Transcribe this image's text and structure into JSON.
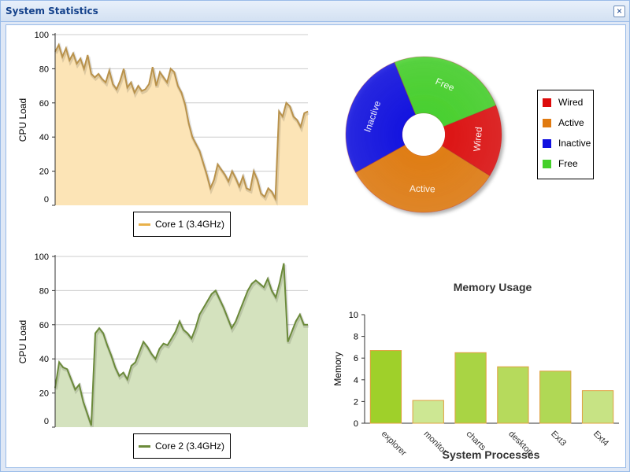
{
  "window": {
    "title": "System Statistics"
  },
  "colors": {
    "core1_line": "#b9924b",
    "core1_fill": "#fce4b6",
    "core1_legend": "#e8b14a",
    "core2_line": "#6b8a3a",
    "core2_fill": "#d4e2be",
    "core2_legend": "#6b8a3a",
    "grid": "#cccccc"
  },
  "cpu1": {
    "ylabel": "CPU Load",
    "legend_label": "Core 1 (3.4GHz)",
    "ticks": [
      "0",
      "20",
      "40",
      "60",
      "80",
      "100"
    ]
  },
  "cpu2": {
    "ylabel": "CPU Load",
    "legend_label": "Core 2 (3.4GHz)",
    "ticks": [
      "0",
      "20",
      "40",
      "60",
      "80",
      "100"
    ]
  },
  "pie": {
    "legend": [
      {
        "label": "Wired",
        "color": "#dd0b0b"
      },
      {
        "label": "Active",
        "color": "#e07a10"
      },
      {
        "label": "Inactive",
        "color": "#1010e0"
      },
      {
        "label": "Free",
        "color": "#44d02a"
      }
    ]
  },
  "bar": {
    "title": "Memory Usage",
    "xlabel": "System Processes",
    "ylabel": "Memory",
    "ticks": [
      "0",
      "2",
      "4",
      "6",
      "8",
      "10"
    ]
  },
  "chart_data": [
    {
      "type": "area",
      "ylabel": "CPU Load",
      "ylim": [
        0,
        100
      ],
      "grid": true,
      "legend": "bottom",
      "series": [
        {
          "name": "Core 1 (3.4GHz)",
          "values": [
            90,
            94,
            87,
            92,
            85,
            89,
            83,
            86,
            80,
            88,
            77,
            75,
            77,
            74,
            72,
            79,
            71,
            68,
            73,
            80,
            69,
            72,
            66,
            70,
            67,
            68,
            71,
            81,
            70,
            78,
            75,
            72,
            80,
            78,
            70,
            66,
            59,
            48,
            40,
            36,
            32,
            25,
            18,
            10,
            15,
            24,
            21,
            18,
            14,
            20,
            16,
            11,
            17,
            10,
            9,
            20,
            15,
            7,
            5,
            10,
            8,
            4,
            55,
            52,
            60,
            58,
            52,
            50,
            46,
            54,
            55
          ]
        }
      ]
    },
    {
      "type": "pie",
      "slices": [
        {
          "label": "Wired",
          "value": 15
        },
        {
          "label": "Active",
          "value": 33
        },
        {
          "label": "Inactive",
          "value": 27
        },
        {
          "label": "Free",
          "value": 25
        }
      ],
      "legend": "right"
    },
    {
      "type": "area",
      "ylabel": "CPU Load",
      "ylim": [
        0,
        100
      ],
      "grid": true,
      "legend": "bottom",
      "series": [
        {
          "name": "Core 2 (3.4GHz)",
          "values": [
            23,
            38,
            35,
            34,
            28,
            22,
            25,
            15,
            8,
            1,
            55,
            58,
            55,
            48,
            42,
            35,
            30,
            32,
            28,
            36,
            38,
            44,
            50,
            47,
            43,
            40,
            46,
            49,
            48,
            52,
            56,
            62,
            57,
            55,
            52,
            58,
            66,
            70,
            74,
            78,
            80,
            75,
            70,
            64,
            58,
            62,
            68,
            74,
            80,
            84,
            86,
            84,
            82,
            87,
            80,
            76,
            85,
            96,
            50,
            56,
            62,
            66,
            60,
            60
          ]
        }
      ]
    },
    {
      "type": "bar",
      "title": "Memory Usage",
      "xlabel": "System Processes",
      "ylabel": "Memory",
      "ylim": [
        0,
        10
      ],
      "categories": [
        "explorer",
        "monitor",
        "charts",
        "desktop",
        "Ext3",
        "Ext4"
      ],
      "values": [
        6.7,
        2.1,
        6.5,
        5.2,
        4.8,
        3.0
      ],
      "colors": [
        "#9fd02a",
        "#cde793",
        "#a9d444",
        "#b6da5c",
        "#b0d855",
        "#c7e384"
      ]
    }
  ]
}
